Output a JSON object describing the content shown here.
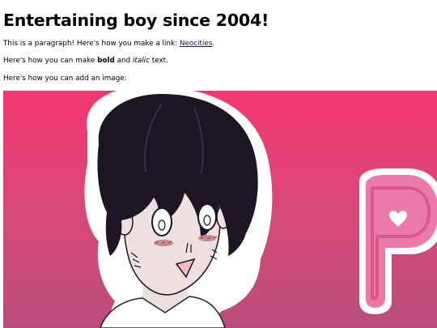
{
  "heading": "Entertaining boy since 2004!",
  "paragraph1": {
    "before": "This is a paragraph! Here's how you make a link: ",
    "link_text": "Neocities",
    "after": "."
  },
  "paragraph2": {
    "before": "Here's how you can make ",
    "bold_text": "bold",
    "middle": " and ",
    "italic_text": "italic",
    "after": " text."
  },
  "paragraph3": {
    "text": "Here's how you can add an image:"
  },
  "image": {
    "subject": "cartoon boy with black hair on pink gradient background with partial pink lettering",
    "gradient_top": "#f2376f",
    "gradient_bottom": "#b94d7a",
    "link_color": "#0000ee"
  }
}
